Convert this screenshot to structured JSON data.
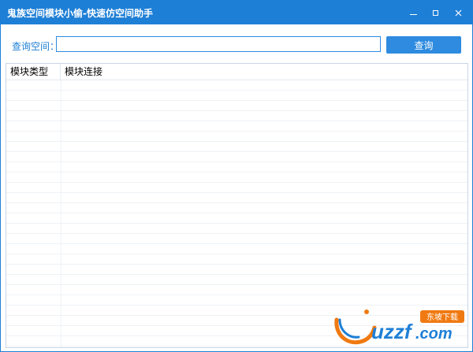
{
  "window": {
    "title": "鬼族空间模块小偷-快速仿空间助手"
  },
  "search": {
    "label": "查询空间：",
    "value": "",
    "placeholder": "",
    "button_label": "查询"
  },
  "table": {
    "columns": [
      "模块类型",
      "模块连接"
    ],
    "rows": []
  },
  "watermark": {
    "text": "uzzf",
    "suffix": ".com",
    "tag": "东坡下载"
  },
  "colors": {
    "accent": "#1e7fd6",
    "button": "#2e8be0",
    "watermark_orange": "#f07a12"
  },
  "icons": [
    "minimize-icon",
    "maximize-icon",
    "close-icon"
  ]
}
